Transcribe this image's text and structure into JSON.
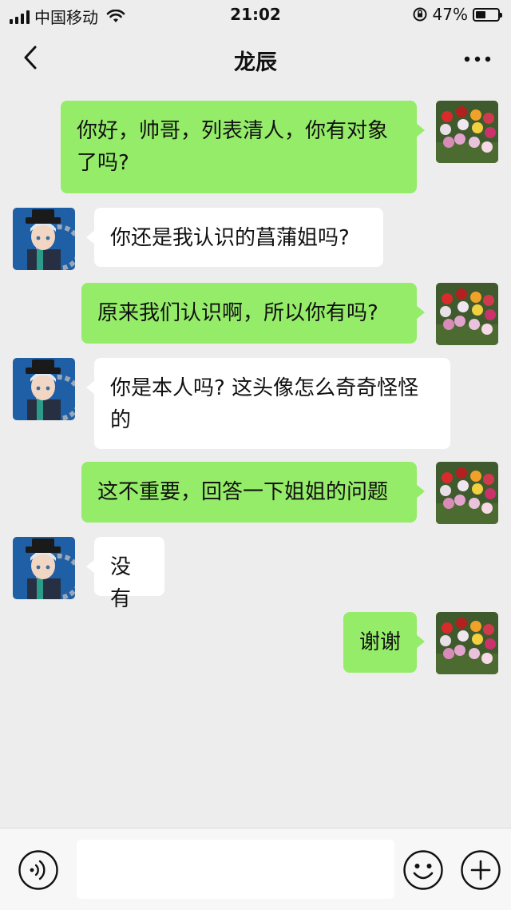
{
  "status_bar": {
    "carrier": "中国移动",
    "time": "21:02",
    "battery_percent": "47%",
    "battery_level": 0.47,
    "icons": [
      "signal-icon",
      "wifi-icon",
      "rotation-lock-icon",
      "battery-icon"
    ]
  },
  "nav": {
    "title": "龙辰",
    "back_icon": "chevron-left-icon",
    "more_icon": "more-dots-icon"
  },
  "messages": [
    {
      "from": "me",
      "text": "你好，帅哥，列表清人，你有对象了吗?"
    },
    {
      "from": "other",
      "text": "你还是我认识的菖蒲姐吗?"
    },
    {
      "from": "me",
      "text": "原来我们认识啊，所以你有吗?"
    },
    {
      "from": "other",
      "text": "你是本人吗? 这头像怎么奇奇怪怪的"
    },
    {
      "from": "me",
      "text": "这不重要，回答一下姐姐的问题"
    },
    {
      "from": "other",
      "text": "没有"
    },
    {
      "from": "me",
      "text": "谢谢"
    }
  ],
  "input_bar": {
    "placeholder": "",
    "voice_icon": "voice-icon",
    "emoji_icon": "emoji-icon",
    "plus_icon": "plus-icon"
  },
  "colors": {
    "background": "#ededed",
    "my_bubble": "#95ec69",
    "other_bubble": "#ffffff",
    "input_bar": "#f7f7f7"
  }
}
